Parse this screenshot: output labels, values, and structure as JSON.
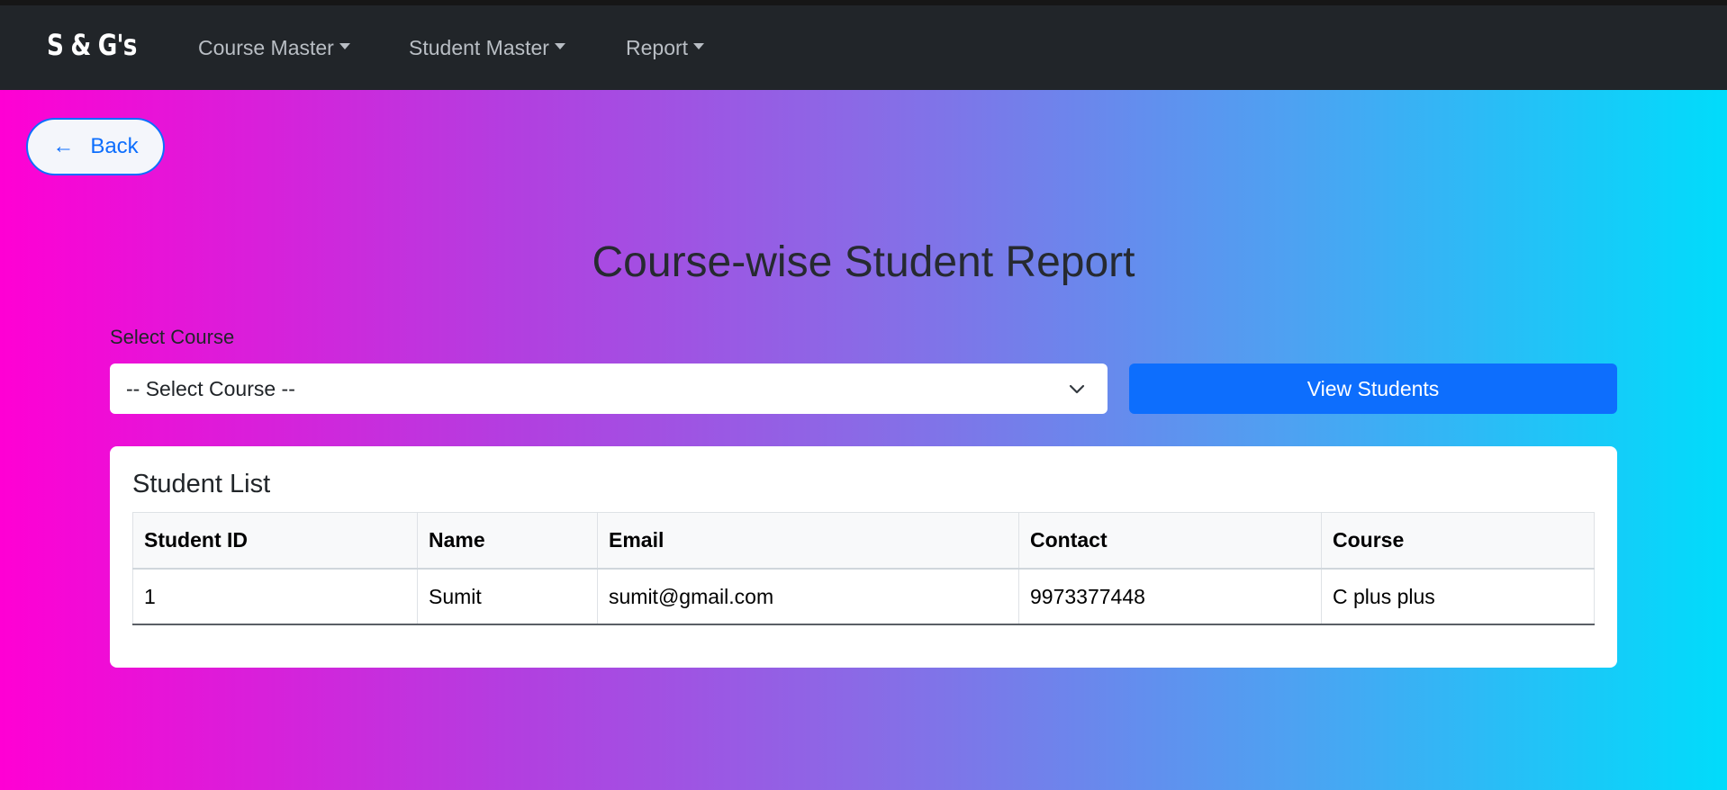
{
  "nav": {
    "brand": "S & G's",
    "items": [
      {
        "label": "Course Master"
      },
      {
        "label": "Student Master"
      },
      {
        "label": "Report"
      }
    ]
  },
  "back_button": {
    "arrow": "←",
    "label": "Back"
  },
  "page_title": "Course-wise Student Report",
  "course_select": {
    "label": "Select Course",
    "selected": "-- Select Course --"
  },
  "view_button": "View Students",
  "student_list": {
    "title": "Student List",
    "columns": [
      "Student ID",
      "Name",
      "Email",
      "Contact",
      "Course"
    ],
    "rows": [
      [
        "1",
        "Sumit",
        "sumit@gmail.com",
        "9973377448",
        "C plus plus"
      ]
    ]
  },
  "colors": {
    "navbar": "#212529",
    "primary": "#0d6efd",
    "gradient_start": "#ff00d4",
    "gradient_end": "#00dcfb"
  },
  "icons": {
    "dropdown_caret": "caret-down-icon",
    "select_chevron": "chevron-down-icon",
    "back_arrow": "arrow-left-icon"
  }
}
